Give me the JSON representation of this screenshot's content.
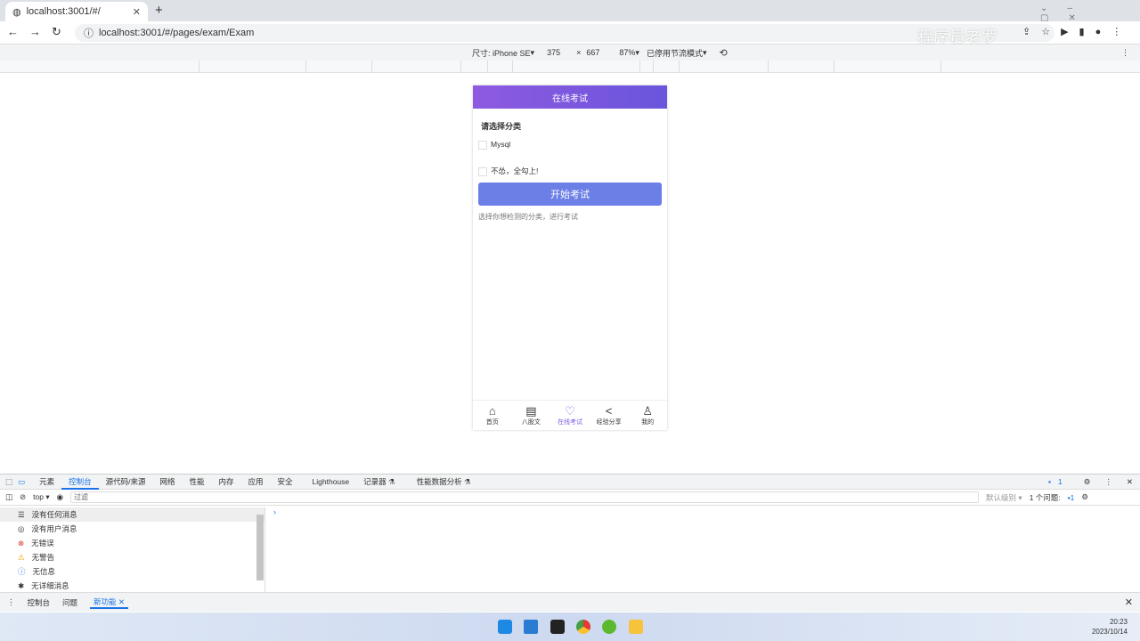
{
  "browser": {
    "tab_title": "localhost:3001/#/",
    "url": "localhost:3001/#/pages/exam/Exam",
    "watermark": "程序员老罗"
  },
  "device_toolbar": {
    "size_label": "尺寸: iPhone SE",
    "width": "375",
    "x": "×",
    "height": "667",
    "zoom": "87%",
    "throttle": "已停用节流模式"
  },
  "app": {
    "header_title": "在线考试",
    "section_title": "请选择分类",
    "options": [
      "Mysql",
      "不怂，全勾上!"
    ],
    "start_button": "开始考试",
    "hint": "选择你想检测的分类，进行考试",
    "nav": [
      {
        "label": "首页",
        "icon": "home-icon"
      },
      {
        "label": "八股文",
        "icon": "clipboard-icon"
      },
      {
        "label": "在线考试",
        "icon": "exam-icon",
        "active": true
      },
      {
        "label": "经验分享",
        "icon": "share-icon"
      },
      {
        "label": "我的",
        "icon": "user-icon"
      }
    ],
    "accent": "#7b5ce0"
  },
  "devtools": {
    "tabs": [
      "元素",
      "控制台",
      "源代码/来源",
      "网络",
      "性能",
      "内存",
      "应用",
      "安全",
      "Lighthouse",
      "记录器 ⚗",
      "性能数据分析 ⚗"
    ],
    "context": "top",
    "filter_placeholder": "过滤",
    "level": "默认级别",
    "issues_label": "1 个问题:",
    "issues_count": "1",
    "badge_count": "1",
    "sidebar": [
      "没有任何消息",
      "没有用户消息",
      "无错误",
      "无警告",
      "无信息",
      "无详细消息"
    ],
    "drawer_tabs": [
      "控制台",
      "问题",
      "新功能"
    ]
  },
  "taskbar": {
    "time": "20:23",
    "date": "2023/10/14"
  }
}
